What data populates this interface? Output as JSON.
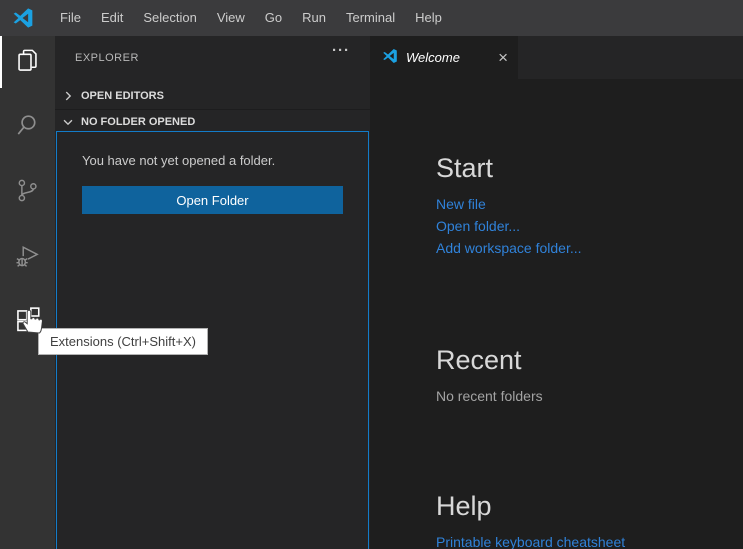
{
  "title_bar": {
    "menu": [
      "File",
      "Edit",
      "Selection",
      "View",
      "Go",
      "Run",
      "Terminal",
      "Help"
    ]
  },
  "activity_bar": {
    "items": [
      {
        "name": "explorer",
        "state": "active"
      },
      {
        "name": "search",
        "state": "idle"
      },
      {
        "name": "source-control",
        "state": "idle"
      },
      {
        "name": "run-and-debug",
        "state": "idle"
      },
      {
        "name": "extensions",
        "state": "hovered"
      }
    ],
    "tooltip": "Extensions (Ctrl+Shift+X)"
  },
  "sidebar": {
    "title": "EXPLORER",
    "more_actions_glyph": "···",
    "open_editors_label": "OPEN EDITORS",
    "no_folder_label": "NO FOLDER OPENED",
    "empty_message": "You have not yet opened a folder.",
    "open_folder_label": "Open Folder"
  },
  "editor": {
    "tab": {
      "label": "Welcome",
      "close_glyph": "×"
    },
    "welcome": {
      "start": {
        "heading": "Start",
        "links": [
          "New file",
          "Open folder...",
          "Add workspace folder..."
        ]
      },
      "recent": {
        "heading": "Recent",
        "empty_text": "No recent folders"
      },
      "help": {
        "heading": "Help",
        "links": [
          "Printable keyboard cheatsheet"
        ]
      }
    }
  },
  "colors": {
    "titlebar_bg": "#3b3b3d",
    "activitybar_bg": "#333333",
    "sidebar_bg": "#252526",
    "editor_bg": "#1e1e1e",
    "focus_border": "#137cc9",
    "button_bg": "#0f639d",
    "link": "#3082d9",
    "logo_blue": "#1ba1e2"
  }
}
